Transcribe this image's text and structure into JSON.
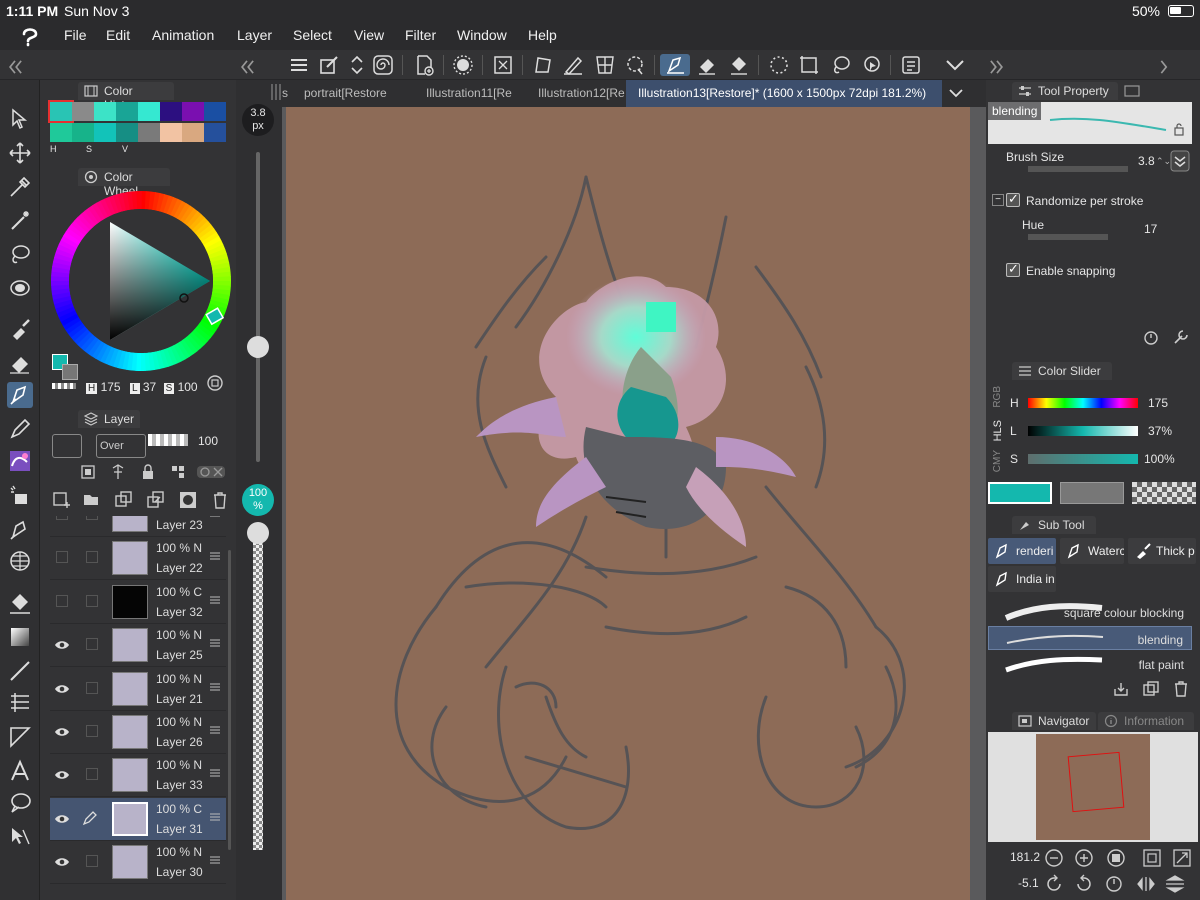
{
  "status": {
    "time": "1:11 PM",
    "date": "Sun Nov 3",
    "battery": "50%"
  },
  "menu": [
    "File",
    "Edit",
    "Animation",
    "Layer",
    "Select",
    "View",
    "Filter",
    "Window",
    "Help"
  ],
  "doc_tabs": [
    "s",
    "portrait[Restore",
    "Illustration11[Re",
    "Illustration12[Re",
    "Illustration13[Restore]* (1600 x 1500px 72dpi 181.2%)"
  ],
  "color_history": {
    "title": "Color History",
    "swatches": [
      "#29c4b4",
      "#8a8a8a",
      "#3ce3c7",
      "#19a596",
      "#35e8d1",
      "#2c0f80",
      "#7a0fb0",
      "#1a4fa3",
      "#1fc99a",
      "#17b38a",
      "#12c3b9",
      "#168e84",
      "#7a7a7a",
      "#f2c3a3",
      "#d9a880",
      "#25509c"
    ],
    "modes": [
      "H",
      "S",
      "V"
    ]
  },
  "color_wheel": {
    "title": "Color Wheel",
    "h_label": "H",
    "h_value": "175",
    "l_label": "L",
    "l_value": "37",
    "s_label": "S",
    "s_value": "100"
  },
  "layer_panel": {
    "title": "Layer",
    "blend_mode": "Over",
    "opacity": "100",
    "layers": [
      {
        "pct": "",
        "name": "Layer 23",
        "visible": false,
        "selected": false,
        "thumb": "#b8b3c9"
      },
      {
        "pct": "100 % N",
        "name": "Layer 22",
        "visible": false,
        "selected": false,
        "thumb": "#b8b3c9"
      },
      {
        "pct": "100 % C",
        "name": "Layer 32",
        "visible": false,
        "selected": false,
        "thumb": "#050505"
      },
      {
        "pct": "100 % N",
        "name": "Layer 25",
        "visible": true,
        "selected": false,
        "thumb": "#b8b3c9"
      },
      {
        "pct": "100 % N",
        "name": "Layer 21",
        "visible": true,
        "selected": false,
        "thumb": "#b8b3c9"
      },
      {
        "pct": "100 % N",
        "name": "Layer 26",
        "visible": true,
        "selected": false,
        "thumb": "#b8b3c9"
      },
      {
        "pct": "100 % N",
        "name": "Layer 33",
        "visible": true,
        "selected": false,
        "thumb": "#b8b3c9"
      },
      {
        "pct": "100 % C",
        "name": "Layer 31",
        "visible": true,
        "selected": true,
        "thumb": "#b8b3c9"
      },
      {
        "pct": "100 % N",
        "name": "Layer 30",
        "visible": true,
        "selected": false,
        "thumb": "#b8b3c9"
      }
    ]
  },
  "brush_size": {
    "value": "3.8",
    "unit": "px",
    "opacity": "100",
    "opacity_unit": "%"
  },
  "tool_property": {
    "title": "Tool Property",
    "preset": "blending",
    "brush_size_label": "Brush Size",
    "brush_size_value": "3.8",
    "randomize_label": "Randomize per stroke",
    "hue_label": "Hue",
    "hue_value": "17",
    "snapping_label": "Enable snapping"
  },
  "color_slider": {
    "title": "Color Slider",
    "modes": [
      "RGB",
      "HLS",
      "CMY"
    ],
    "rows": [
      {
        "label": "H",
        "value": "175"
      },
      {
        "label": "L",
        "value": "37%"
      },
      {
        "label": "S",
        "value": "100%"
      }
    ],
    "main_color": "#14b8ae",
    "sub_color": "#777777"
  },
  "sub_tool": {
    "title": "Sub Tool",
    "tabs": [
      "renderi",
      "Waterc",
      "Thick p",
      "India in"
    ],
    "brushes": [
      "square colour blocking",
      "blending",
      "flat paint"
    ]
  },
  "navigator": {
    "title": "Navigator",
    "info_tab": "Information",
    "zoom": "181.2",
    "rotation": "-5.1"
  }
}
